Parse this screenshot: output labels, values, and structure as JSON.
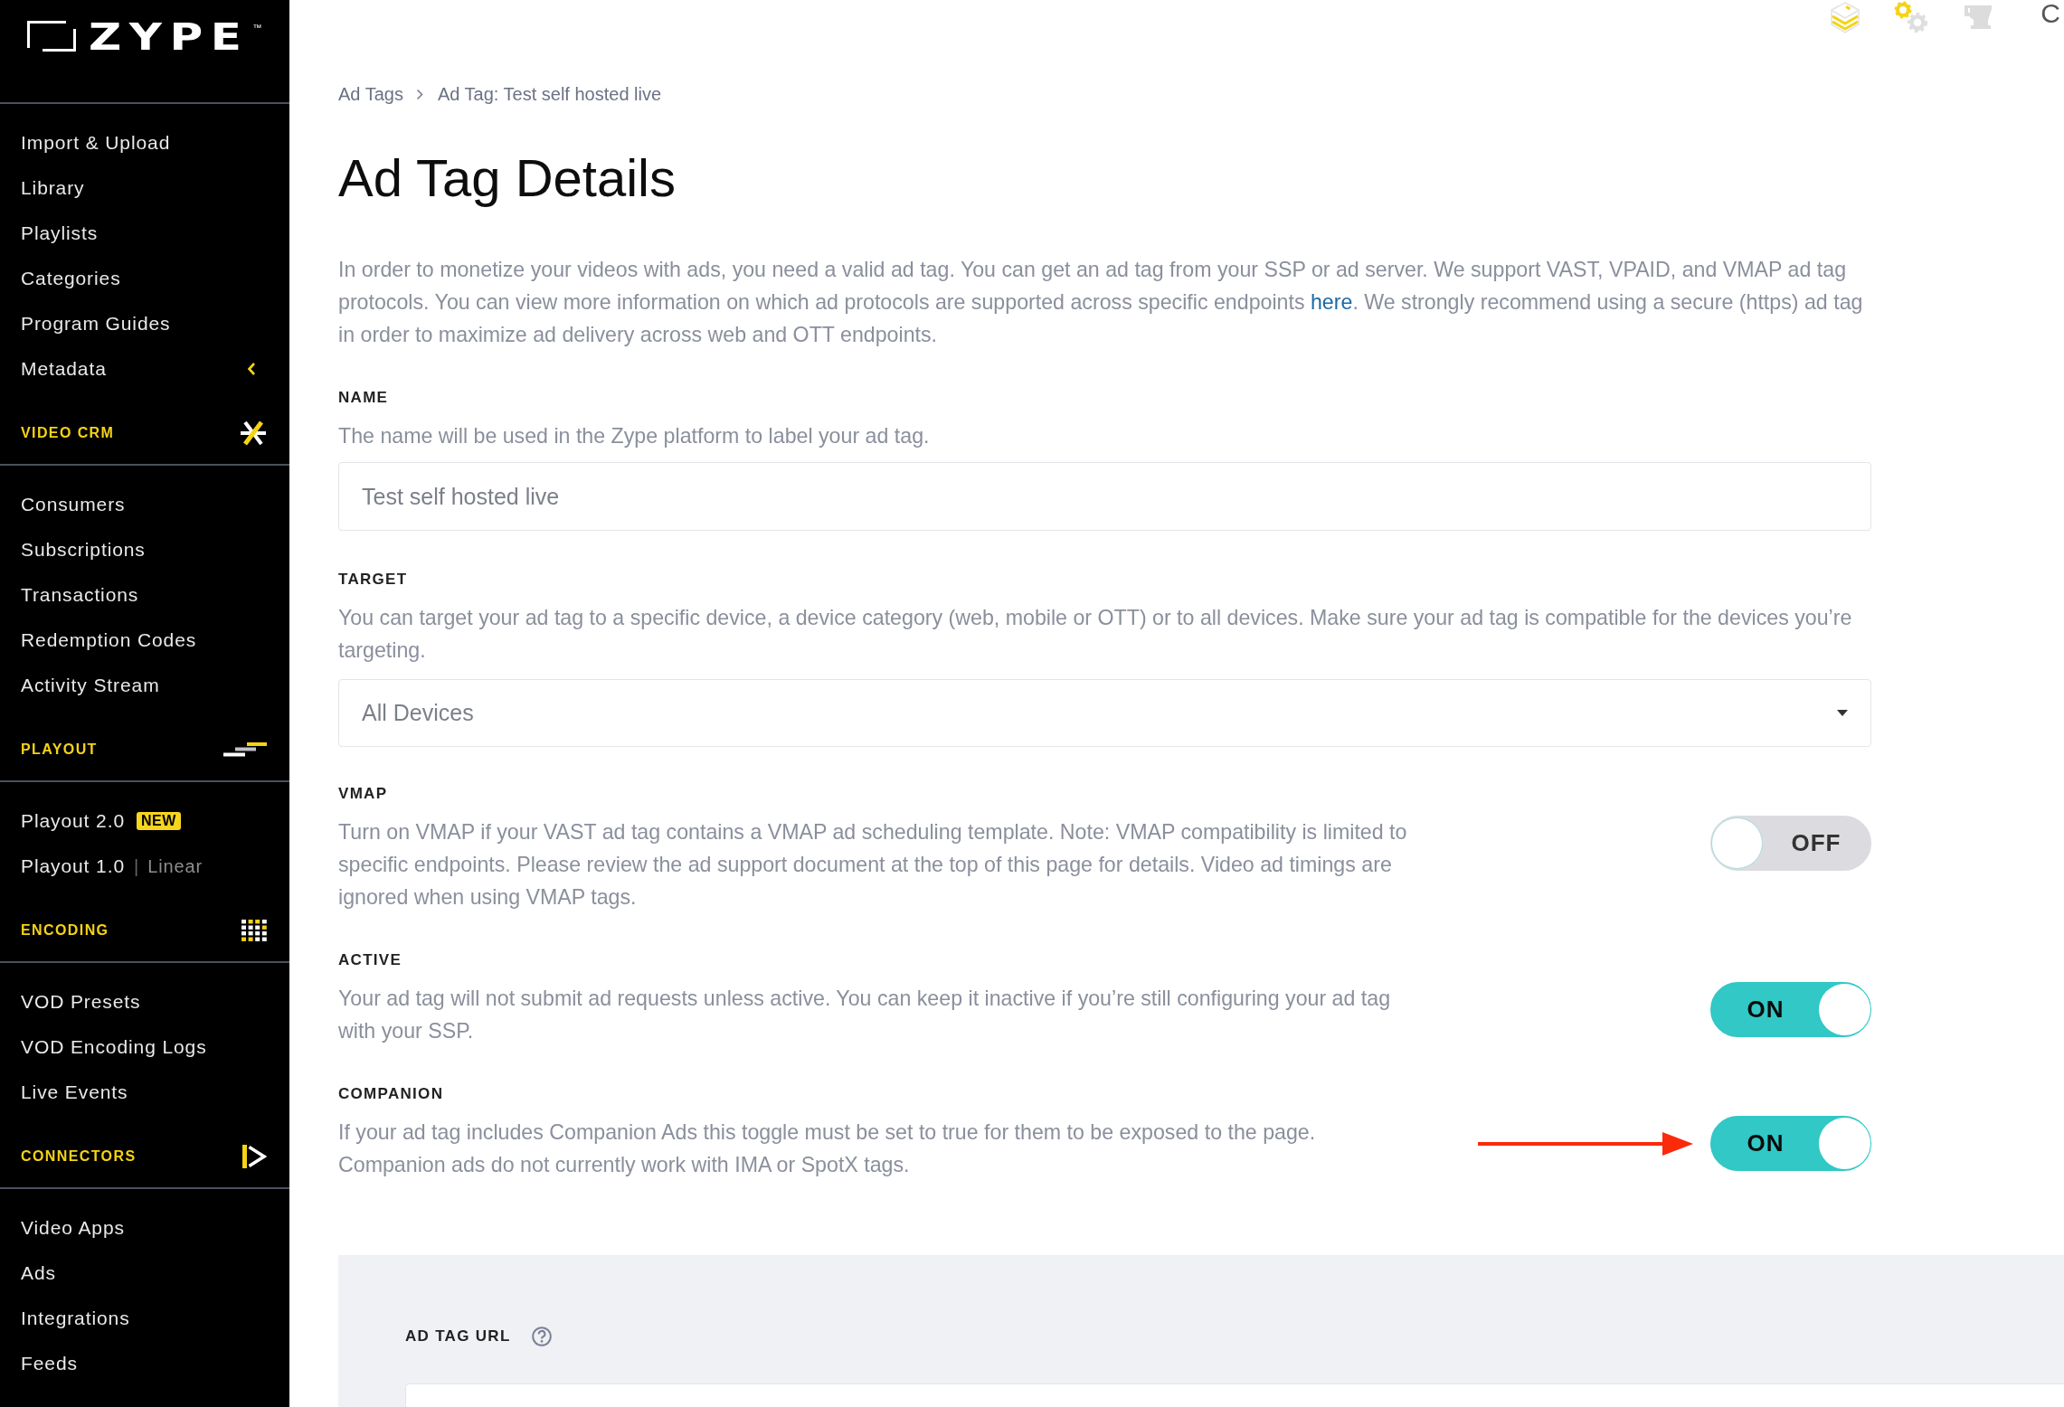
{
  "sidebar": {
    "logo": {
      "text": "ZYPE",
      "trademark": "™"
    },
    "groups": [
      {
        "items": [
          {
            "label": "Import & Upload",
            "kind": "link"
          },
          {
            "label": "Library",
            "kind": "link"
          },
          {
            "label": "Playlists",
            "kind": "link"
          },
          {
            "label": "Categories",
            "kind": "link"
          },
          {
            "label": "Program Guides",
            "kind": "link"
          },
          {
            "label": "Metadata",
            "kind": "submenu"
          }
        ]
      },
      {
        "heading": "VIDEO CRM",
        "items": [
          {
            "label": "Consumers",
            "kind": "link"
          },
          {
            "label": "Subscriptions",
            "kind": "link"
          },
          {
            "label": "Transactions",
            "kind": "link"
          },
          {
            "label": "Redemption Codes",
            "kind": "link"
          },
          {
            "label": "Activity Stream",
            "kind": "link"
          }
        ]
      },
      {
        "heading": "PLAYOUT",
        "items": [
          {
            "label": "Playout 2.0",
            "kind": "badge",
            "badge": "NEW"
          },
          {
            "label": "Playout 1.0",
            "kind": "note",
            "separator": "|",
            "note": "Linear"
          }
        ]
      },
      {
        "heading": "ENCODING",
        "items": [
          {
            "label": "VOD Presets",
            "kind": "link"
          },
          {
            "label": "VOD Encoding Logs",
            "kind": "link"
          },
          {
            "label": "Live Events",
            "kind": "link"
          }
        ]
      },
      {
        "heading": "CONNECTORS",
        "items": [
          {
            "label": "Video Apps",
            "kind": "link"
          },
          {
            "label": "Ads",
            "kind": "link"
          },
          {
            "label": "Integrations",
            "kind": "link"
          },
          {
            "label": "Feeds",
            "kind": "link"
          }
        ]
      }
    ]
  },
  "top_bar": {
    "partial_text": "C"
  },
  "breadcrumb": [
    {
      "label": "Ad Tags"
    },
    {
      "label": "Ad Tag: Test self hosted live"
    }
  ],
  "title": "Ad Tag Details",
  "intro": {
    "text_before": "In order to monetize your videos with ads, you need a valid ad tag. You can get an ad tag from your SSP or ad server. We support VAST, VPAID, and VMAP ad tag protocols. You can view more information on which ad protocols are supported across specific endpoints ",
    "link": "here",
    "text_after": ". We strongly recommend using a secure (https) ad tag in order to maximize ad delivery across web and OTT endpoints."
  },
  "fields": [
    {
      "kind": "text",
      "label": "NAME",
      "description": "The name will be used in the Zype platform to label your ad tag.",
      "value": "Test self hosted live",
      "annotated": false
    },
    {
      "kind": "select",
      "label": "TARGET",
      "description": "You can target your ad tag to a specific device, a device category (web, mobile or OTT) or to all devices. Make sure your ad tag is compatible for the devices you’re targeting.",
      "value": "All Devices",
      "annotated": false
    },
    {
      "kind": "toggle",
      "label": "VMAP",
      "description": "Turn on VMAP if your VAST ad tag contains a VMAP ad scheduling template. Note: VMAP compatibility is limited to specific endpoints. Please review the ad support document at the top of this page for details. Video ad timings are ignored when using VMAP tags.",
      "on": false,
      "state_label": "OFF",
      "annotated": false
    },
    {
      "kind": "toggle",
      "label": "ACTIVE",
      "description": "Your ad tag will not submit ad requests unless active. You can keep it inactive if you’re still configuring your ad tag with your SSP.",
      "on": true,
      "state_label": "ON",
      "annotated": false
    },
    {
      "kind": "toggle",
      "label": "COMPANION",
      "description": "If your ad tag includes Companion Ads this toggle must be set to true for them to be exposed to the page. Companion ads do not currently work with IMA or SpotX tags.",
      "on": true,
      "state_label": "ON",
      "annotated": true
    }
  ],
  "url_panel": {
    "label": "AD TAG URL"
  }
}
